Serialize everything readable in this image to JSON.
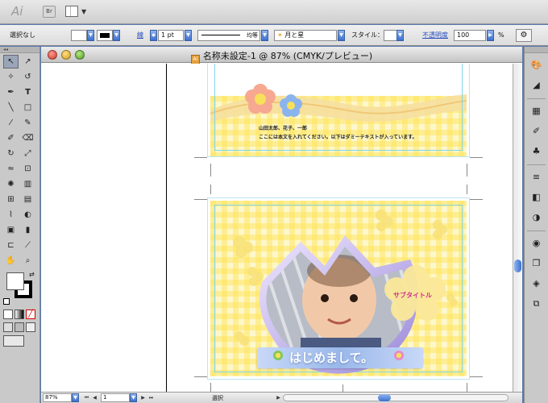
{
  "app": {
    "logo": "Ai",
    "bridge_label": "Br"
  },
  "control_bar": {
    "selection_status": "選択なし",
    "stroke_label": "線",
    "stroke_weight": "1 pt",
    "stroke_profile": "均等",
    "brush": "月と星",
    "style_label": "スタイル：",
    "opacity_label": "不透明度",
    "opacity_value": "100",
    "opacity_unit": "%"
  },
  "document": {
    "title": "名称未設定-1 @ 87% (CMYK/プレビュー)",
    "page1": {
      "names": "山田太郎、花子、一郎",
      "body_text": "ここには本文を入れてください。以下はダミーテキストが入っています。"
    },
    "page2": {
      "subtitle": "サブタイトル",
      "banner_text": "はじめまして。"
    }
  },
  "status_bar": {
    "zoom": "87%",
    "page": "1",
    "mode": "選択"
  },
  "colors": {
    "accent": "#3c6fd0",
    "gingham": "#fde97a",
    "guide": "#7fd6e8",
    "subtitle": "#d0308a"
  }
}
